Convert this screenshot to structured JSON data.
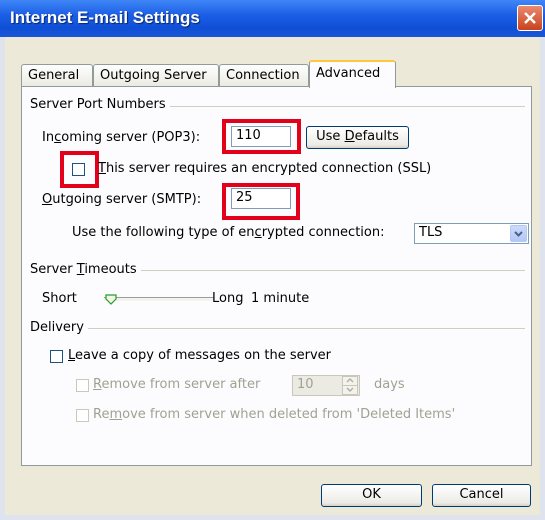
{
  "window": {
    "title": "Internet E-mail Settings"
  },
  "tabs": [
    {
      "label": "General",
      "active": false
    },
    {
      "label": "Outgoing Server",
      "active": false
    },
    {
      "label": "Connection",
      "active": false
    },
    {
      "label": "Advanced",
      "active": true
    }
  ],
  "server_ports": {
    "group_label": "Server Port Numbers",
    "incoming_label_pre": "In",
    "incoming_label_u": "c",
    "incoming_label_post": "oming server (POP3):",
    "incoming_value": "110",
    "use_defaults_pre": "Use ",
    "use_defaults_u": "D",
    "use_defaults_post": "efaults",
    "ssl_label_u": "T",
    "ssl_label_post": "his server requires an encrypted connection (SSL)",
    "ssl_checked": false,
    "outgoing_label_u": "O",
    "outgoing_label_post": "utgoing server (SMTP):",
    "outgoing_value": "25",
    "encryption_label_pre": "Use the following type of en",
    "encryption_label_u": "c",
    "encryption_label_post": "rypted connection:",
    "encryption_value": "TLS"
  },
  "timeouts": {
    "group_label_pre": "Server ",
    "group_label_u": "T",
    "group_label_post": "imeouts",
    "short_label": "Short",
    "long_label": "Long",
    "value_label": "1 minute",
    "slider_position": 0.0
  },
  "delivery": {
    "group_label": "Delivery",
    "leave_copy_u": "L",
    "leave_copy_post": "eave a copy of messages on the server",
    "leave_copy_checked": false,
    "remove_after_u": "R",
    "remove_after_post": "emove from server after",
    "remove_after_days": "10",
    "days_label": "days",
    "remove_deleted_pre": "Re",
    "remove_deleted_u": "m",
    "remove_deleted_post": "ove from server when deleted from 'Deleted Items'"
  },
  "footer": {
    "ok_label": "OK",
    "cancel_label": "Cancel"
  },
  "colors": {
    "highlight": "#e3001b",
    "titlebar": "#1c5fe6",
    "tab_active_border": "#ffc83c"
  }
}
